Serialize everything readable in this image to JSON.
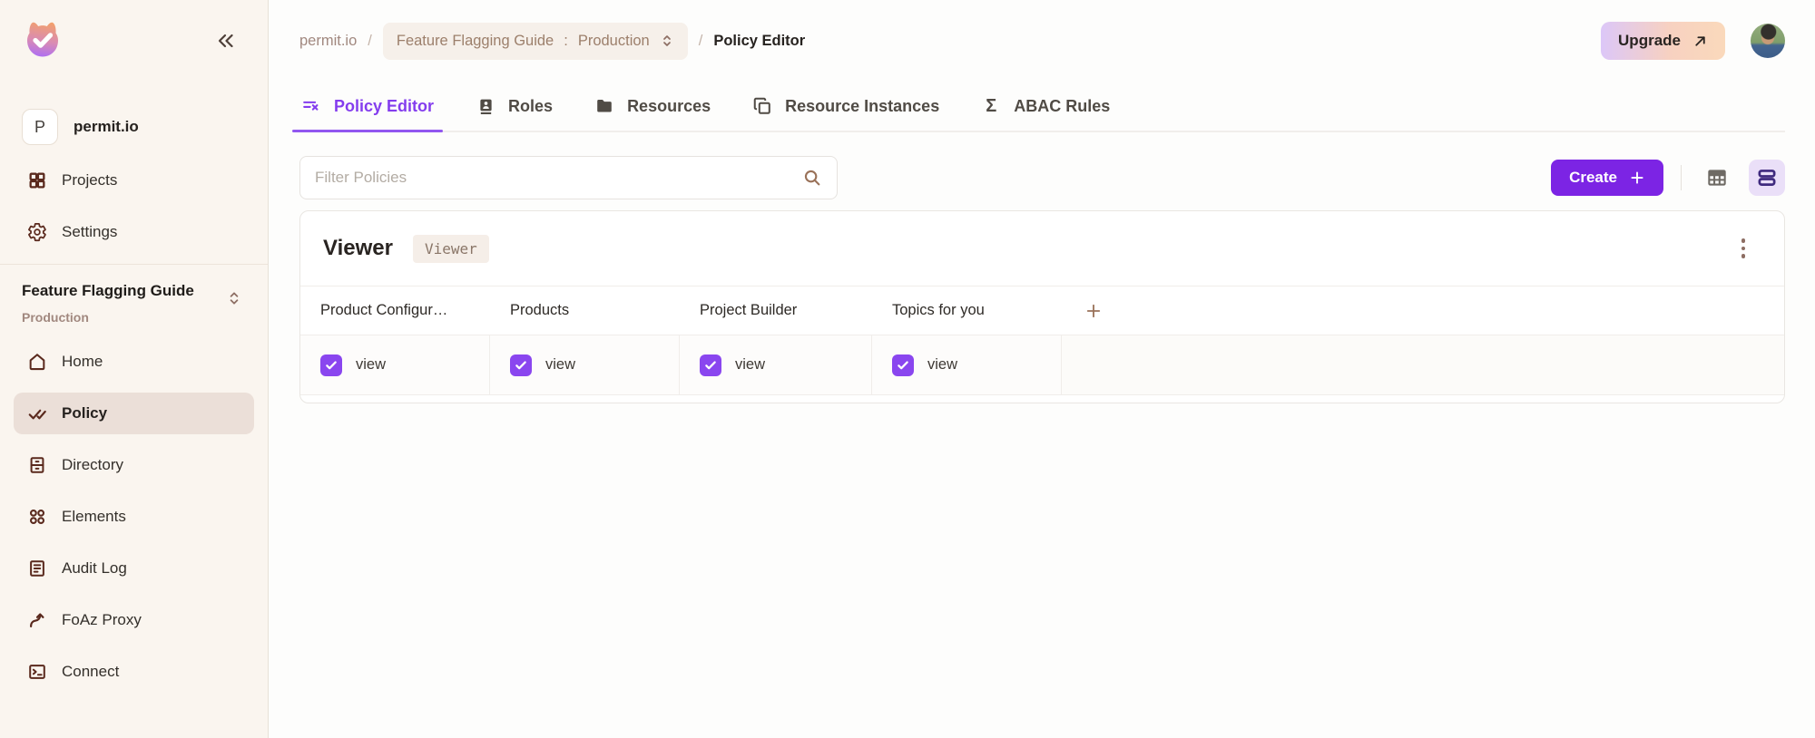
{
  "colors": {
    "accent_purple": "#843DEE",
    "create_button_purple": "#7C24E4",
    "checkbox_purple": "#8A46EF",
    "sidebar_bg": "#FAF5EF",
    "sidebar_selected_bg": "#EBDFD8",
    "brown_accent": "#9A7259",
    "upgrade_gradient": [
      "#DCC7F8",
      "#FAD9BB"
    ]
  },
  "sidebar": {
    "org": {
      "badge": "P",
      "name": "permit.io"
    },
    "top_items": [
      {
        "label": "Projects"
      },
      {
        "label": "Settings"
      }
    ],
    "project_switcher": {
      "name": "Feature Flagging Guide",
      "environment": "Production"
    },
    "items": [
      {
        "label": "Home",
        "active": false
      },
      {
        "label": "Policy",
        "active": true
      },
      {
        "label": "Directory",
        "active": false
      },
      {
        "label": "Elements",
        "active": false
      },
      {
        "label": "Audit Log",
        "active": false
      },
      {
        "label": "FoAz Proxy",
        "active": false
      },
      {
        "label": "Connect",
        "active": false
      }
    ]
  },
  "header": {
    "breadcrumb": {
      "org": "permit.io",
      "separator": "/",
      "project": "Feature Flagging Guide",
      "colon": ":",
      "environment": "Production",
      "page": "Policy Editor"
    },
    "upgrade_label": "Upgrade"
  },
  "tabs": [
    {
      "label": "Policy Editor",
      "icon": "filter-x-icon",
      "active": true
    },
    {
      "label": "Roles",
      "icon": "id-badge-icon",
      "active": false
    },
    {
      "label": "Resources",
      "icon": "folder-icon",
      "active": false
    },
    {
      "label": "Resource Instances",
      "icon": "copy-icon",
      "active": false
    },
    {
      "label": "ABAC Rules",
      "icon": "sigma-icon",
      "active": false
    }
  ],
  "toolbar": {
    "filter_placeholder": "Filter Policies",
    "create_label": "Create",
    "view_modes": [
      "grid",
      "list"
    ],
    "active_view_mode": "list"
  },
  "role_card": {
    "title": "Viewer",
    "badge": "Viewer",
    "columns": [
      "Product Configur…",
      "Products",
      "Project Builder",
      "Topics for you"
    ],
    "rows": [
      {
        "cells": [
          {
            "checked": true,
            "label": "view"
          },
          {
            "checked": true,
            "label": "view"
          },
          {
            "checked": true,
            "label": "view"
          },
          {
            "checked": true,
            "label": "view"
          }
        ]
      }
    ]
  }
}
